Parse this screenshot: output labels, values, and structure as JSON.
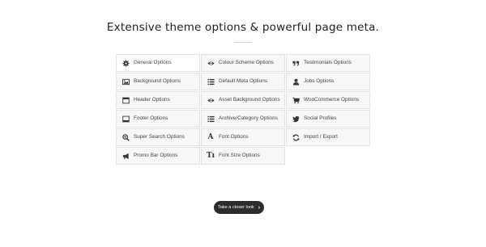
{
  "heading": "Extensive theme options & powerful page meta.",
  "columns": [
    [
      {
        "label": "General Options",
        "icon": "gear-icon",
        "active": true
      },
      {
        "label": "Background Options",
        "icon": "image-icon"
      },
      {
        "label": "Header Options",
        "icon": "header-window-icon"
      },
      {
        "label": "Footer Options",
        "icon": "footer-window-icon"
      },
      {
        "label": "Super Search Options",
        "icon": "search-icon"
      },
      {
        "label": "Promo Bar Options",
        "icon": "megaphone-icon"
      }
    ],
    [
      {
        "label": "Colour Scheme Options",
        "icon": "eye-icon"
      },
      {
        "label": "Default Meta Options",
        "icon": "list-icon"
      },
      {
        "label": "Asset Background Options",
        "icon": "eye-icon"
      },
      {
        "label": "Archive/Category Options",
        "icon": "list-icon"
      },
      {
        "label": "Font Options",
        "icon": "font-icon",
        "glyph": "A"
      },
      {
        "label": "Font Size Options",
        "icon": "font-size-icon",
        "glyph": "Tı"
      }
    ],
    [
      {
        "label": "Testimonials Options",
        "icon": "quote-icon"
      },
      {
        "label": "Jobs Options",
        "icon": "user-icon"
      },
      {
        "label": "WooCommerce Options",
        "icon": "cart-icon"
      },
      {
        "label": "Social Profiles",
        "icon": "twitter-icon"
      },
      {
        "label": "Import / Export",
        "icon": "refresh-icon"
      }
    ]
  ],
  "cta": {
    "label": "Take a closer look",
    "icon": "chevron-right-icon"
  }
}
